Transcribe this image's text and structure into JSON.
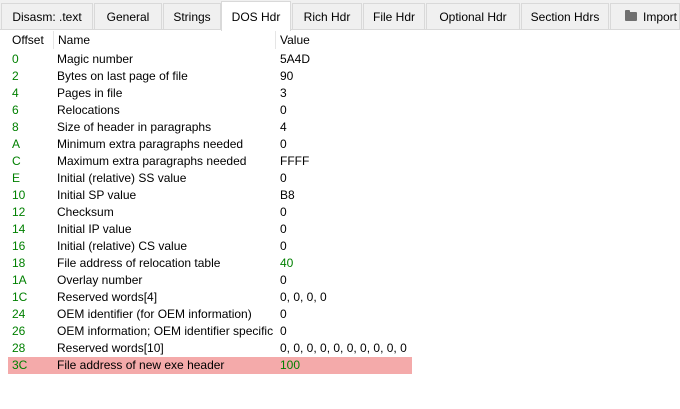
{
  "tabs": [
    {
      "label": "Disasm: .text",
      "active": false
    },
    {
      "label": "General",
      "active": false
    },
    {
      "label": "Strings",
      "active": false
    },
    {
      "label": "DOS Hdr",
      "active": true
    },
    {
      "label": "Rich Hdr",
      "active": false
    },
    {
      "label": "File Hdr",
      "active": false
    },
    {
      "label": "Optional Hdr",
      "active": false
    },
    {
      "label": "Section Hdrs",
      "active": false
    },
    {
      "label": "Import",
      "active": false,
      "icon": "folder-icon"
    }
  ],
  "columns": {
    "offset": "Offset",
    "name": "Name",
    "value": "Value"
  },
  "rows": [
    {
      "offset": "0",
      "name": "Magic number",
      "value": "5A4D"
    },
    {
      "offset": "2",
      "name": "Bytes on last page of file",
      "value": "90"
    },
    {
      "offset": "4",
      "name": "Pages in file",
      "value": "3"
    },
    {
      "offset": "6",
      "name": "Relocations",
      "value": "0"
    },
    {
      "offset": "8",
      "name": "Size of header in paragraphs",
      "value": "4"
    },
    {
      "offset": "A",
      "name": "Minimum extra paragraphs needed",
      "value": "0"
    },
    {
      "offset": "C",
      "name": "Maximum extra paragraphs needed",
      "value": "FFFF"
    },
    {
      "offset": "E",
      "name": "Initial (relative) SS value",
      "value": "0"
    },
    {
      "offset": "10",
      "name": "Initial SP value",
      "value": "B8"
    },
    {
      "offset": "12",
      "name": "Checksum",
      "value": "0"
    },
    {
      "offset": "14",
      "name": "Initial IP value",
      "value": "0"
    },
    {
      "offset": "16",
      "name": "Initial (relative) CS value",
      "value": "0"
    },
    {
      "offset": "18",
      "name": "File address of relocation table",
      "value": "40",
      "value_color": "#008000"
    },
    {
      "offset": "1A",
      "name": "Overlay number",
      "value": "0"
    },
    {
      "offset": "1C",
      "name": "Reserved words[4]",
      "value": "0, 0, 0, 0"
    },
    {
      "offset": "24",
      "name": "OEM identifier (for OEM information)",
      "value": "0"
    },
    {
      "offset": "26",
      "name": "OEM information; OEM identifier specific",
      "value": "0"
    },
    {
      "offset": "28",
      "name": "Reserved words[10]",
      "value": "0, 0, 0, 0, 0, 0, 0, 0, 0, 0"
    },
    {
      "offset": "3C",
      "name": "File address of new exe header",
      "value": "100",
      "value_color": "#008000",
      "selected": true
    }
  ],
  "colors": {
    "offset_text": "#008000",
    "selection": "#f4aaaa"
  }
}
